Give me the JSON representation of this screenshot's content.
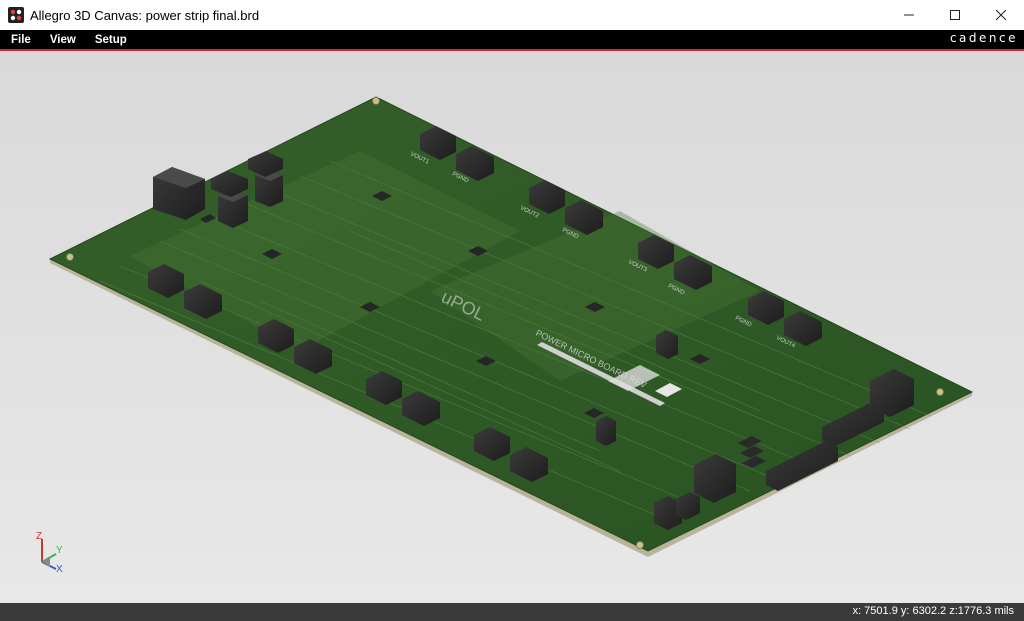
{
  "window": {
    "title": "Allegro 3D Canvas: power strip final.brd",
    "controls": [
      "minimize-icon",
      "maximize-icon",
      "close-icon"
    ]
  },
  "menu": {
    "items": [
      "File",
      "View",
      "Setup"
    ],
    "brand": "cadence"
  },
  "board": {
    "silkscreen_main": "uPOL",
    "silkscreen_title": "POWER MICRO BOARD REV",
    "labels": [
      "VOUT1",
      "PGND",
      "VOUT2",
      "PGND",
      "VOUT3",
      "PGND",
      "PGND",
      "VOUT4"
    ]
  },
  "axes": {
    "z": "Z",
    "y": "Y",
    "x": "X"
  },
  "status": {
    "coords": "x: 7501.9 y: 6302.2 z:1776.3 mils"
  },
  "colors": {
    "viewport_bg": "#e1e1e1",
    "board_green": "#2f5a26",
    "accent_red": "#d0262b"
  }
}
